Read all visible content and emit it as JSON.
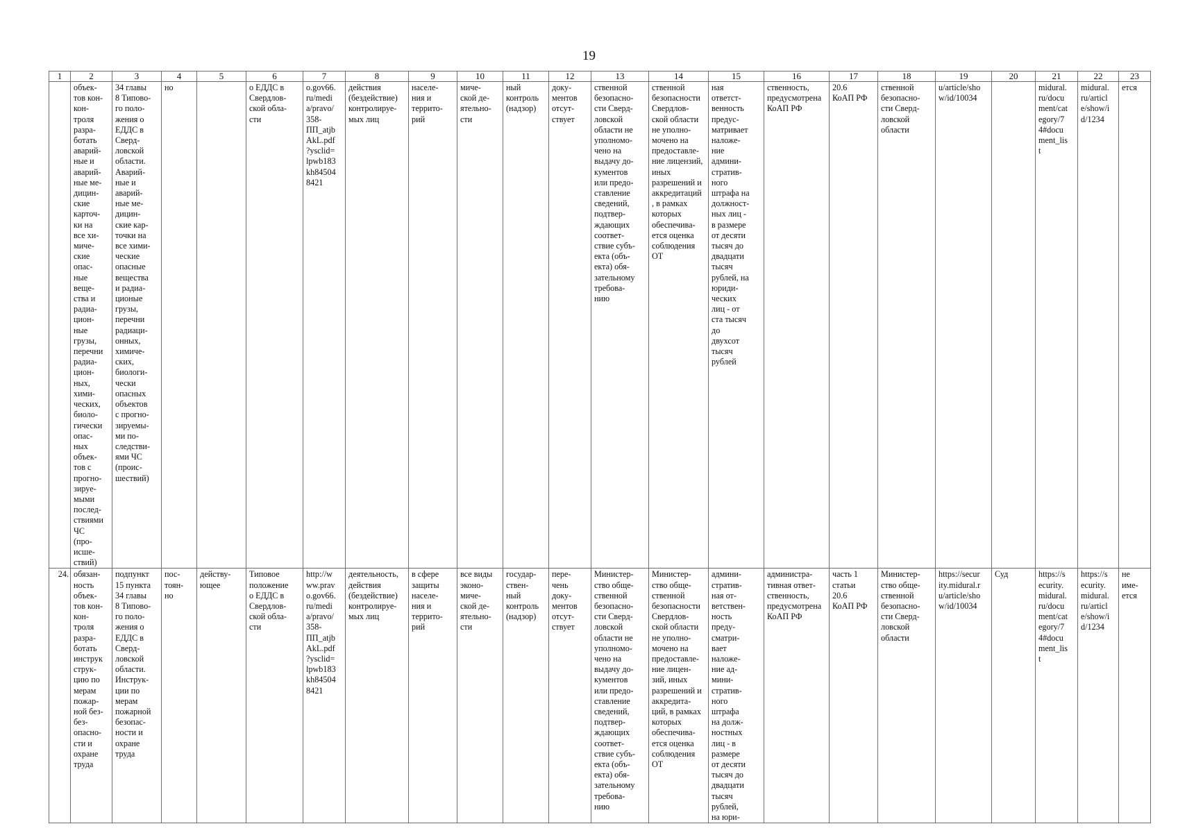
{
  "page_number": "19",
  "table": {
    "headers": [
      "1",
      "2",
      "3",
      "4",
      "5",
      "6",
      "7",
      "8",
      "9",
      "10",
      "11",
      "12",
      "13",
      "14",
      "15",
      "16",
      "17",
      "18",
      "19",
      "20",
      "21",
      "22",
      "23"
    ],
    "rows": [
      {
        "cells": [
          "",
          "объек-\nтов кон-\nкон-\nтроля\nразра-\nботать\nаварий-\nные и\nаварий-\nные ме-\nдицин-\nские\nкарточ-\nки на\nвсе хи-\nмиче-\nские\nопас-\nные\nвеще-\nства и\nрадиа-\nцион-\nные\nгрузы,\nперечни\nрадиа-\nцион-\nных,\nхими-\nческих,\nбиоло-\nгически\nопас-\nных\nобъек-\nтов с\nпрогно-\nзируе-\nмыми\nпослед-\nствиями\nЧС\n(про-\nисше-\nствий)",
          "34 главы\n8 Типово-\nго поло-\nжения о\nЕДДС в\nСверд-\nловской\nобласти.\nАварий-\nные и\nаварий-\nные ме-\nдицин-\nские кар-\nточки на\nвсе хими-\nческие\nопасные\nвещества\nи радиа-\nционые\nгрузы,\nперечни\nрадиаци-\nонных,\nхимиче-\nских,\nбиологи-\nчески\nопасных\nобъектов\nс прогно-\nзируемы-\nми по-\nследстви-\nями ЧС\n(проис-\nшествий)",
          "но",
          "",
          "о ЕДДС в\nСвердлов-\nской обла-\nсти",
          "o.gov66.\nru/medi\na/pravo/\n358-\nПП_atjb\nAkL.pdf\n?ysclid=\nlpwb183\nkh84504\n8421",
          "действия\n(бездействие)\nконтролируе-\nмых лиц",
          "населе-\nния и\nтеррито-\nрий",
          "миче-\nской де-\nятельно-\nсти",
          "ный\nконтроль\n(надзор)",
          "доку-\nментов\nотсут-\nствует",
          "ственной\nбезопасно-\nсти Сверд-\nловской\nобласти не\nуполномо-\nчено на\nвыдачу до-\nкументов\nили предо-\nставление\nсведений,\nподтвер-\nждающих\nсоответ-\nствие субъ-\nекта (объ-\nекта) обя-\nзательному\nтребова-\nнию",
          "ственной\nбезопасности\nСвердлов-\nской области\nне уполно-\nмочено на\nпредоставле-\nние лицензий,\nиных\nразрешений и\nаккредитаций\n, в рамках\nкоторых\nобеспечива-\nется оценка\nсоблюдения\nОТ",
          "ная\nответст-\nвенность\nпредус-\nматривает\nналоже-\nние\nадмини-\nстратив-\nного\nштрафа на\nдолжност-\nных лиц -\nв размере\nот десяти\nтысяч до\nдвадцати\nтысяч\nрублей, на\nюриди-\nческих\nлиц - от\nста тысяч\nдо\nдвухсот\nтысяч\nрублей",
          "ственность,\nпредусмотрена\nКоАП РФ",
          "20.6\nКоАП РФ",
          "ственной\nбезопасно-\nсти Сверд-\nловской\nобласти",
          "u/article/sho\nw/id/10034",
          "",
          "midural.\nru/docu\nment/cat\negory/7\n4#docu\nment_lis\nt",
          "midural.\nru/articl\ne/show/i\nd/1234",
          "ется"
        ]
      },
      {
        "cells": [
          "24.",
          "обязан-\nность\nобъек-\nтов кон-\nкон-\nтроля\nразра-\nботать\nинструк\nструк-\nцию по\nмерам\nпожар-\nной без-\nбез-\nопасно-\nсти и\nохране\nтруда",
          "подпункт\n15 пункта\n34 главы\n8 Типово-\nго поло-\nжения о\nЕДДС в\nСверд-\nловской\nобласти.\nИнструк-\nции по\nмерам\nпожарной\nбезопас-\nности и\nохране\nтруда",
          "пос-\nтоян-\nно",
          "действу-\nющее",
          "Типовое\nположение\nо ЕДДС в\nСвердлов-\nской обла-\nсти",
          "http://w\nww.prav\no.gov66.\nru/medi\na/pravo/\n358-\nПП_atjb\nAkL.pdf\n?ysclid=\nlpwb183\nkh84504\n8421",
          "деятельность,\nдействия\n(бездействие)\nконтролируе-\nмых лиц",
          "в сфере\nзащиты\nнаселе-\nния и\nтеррито-\nрий",
          "все виды\nэконо-\nмиче-\nской де-\nятельно-\nсти",
          "государ-\nствен-\nный\nконтроль\n(надзор)",
          "пере-\nчень\nдоку-\nментов\nотсут-\nствует",
          "Министер-\nство обще-\nственной\nбезопасно-\nсти Сверд-\nловской\nобласти не\nуполномо-\nчено на\nвыдачу до-\nкументов\nили предо-\nставление\nсведений,\nподтвер-\nждающих\nсоответ-\nствие субъ-\nекта (объ-\nекта) обя-\nзательному\nтребова-\nнию",
          "Министер-\nство обще-\nственной\nбезопасности\nСвердлов-\nской области\nне уполно-\nмочено на\nпредоставле-\nние лицен-\nзий, иных\nразрешений и\nаккредита-\nций, в рамках\nкоторых\nобеспечива-\nется оценка\nсоблюдения\nОТ",
          "админи-\nстратив-\nная от-\nветствен-\nность\nпреду-\nсматри-\nвает\nналоже-\nние ад-\nмини-\nстратив-\nного\nштрафа\nна долж-\nностных\nлиц - в\nразмере\nот десяти\nтысяч до\nдвадцати\nтысяч\nрублей,\nна юри-",
          "администра-\nтивная ответ-\nственность,\nпредусмотрена\nКоАП РФ",
          "часть 1\nстатьи\n20.6\nКоАП РФ",
          "Министер-\nство обще-\nственной\nбезопасно-\nсти Сверд-\nловской\nобласти",
          "https://secur\nity.midural.r\nu/article/sho\nw/id/10034",
          "Суд",
          "https://s\necurity.\nmidural.\nru/docu\nment/cat\negory/7\n4#docu\nment_lis\nt",
          "https://s\necurity.\nmidural.\nru/articl\ne/show/i\nd/1234",
          "не\nиме-\nется"
        ]
      }
    ]
  }
}
